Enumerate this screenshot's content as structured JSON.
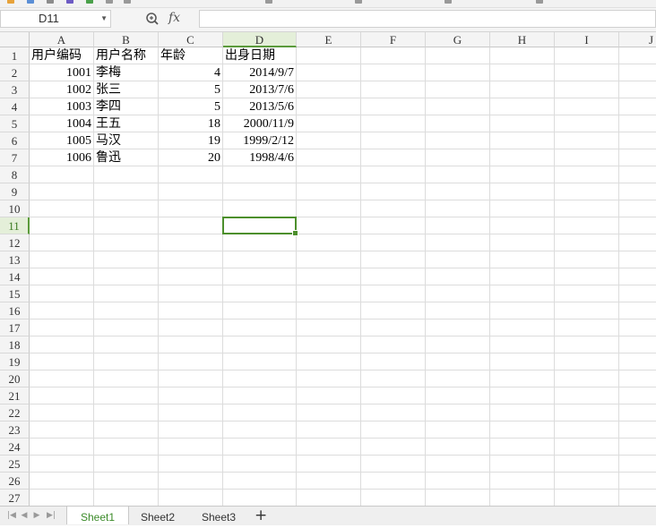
{
  "formula_bar": {
    "name_box": "D11",
    "fx_label": "fx",
    "formula": ""
  },
  "columns": [
    "A",
    "B",
    "C",
    "D",
    "E",
    "F",
    "G",
    "H",
    "I",
    "J"
  ],
  "rows": [
    "1",
    "2",
    "3",
    "4",
    "5",
    "6",
    "7",
    "8",
    "9",
    "10",
    "11",
    "12",
    "13",
    "14",
    "15",
    "16",
    "17",
    "18",
    "19",
    "20",
    "21",
    "22",
    "23",
    "24",
    "25",
    "26",
    "27"
  ],
  "table": {
    "headers": [
      "用户编码",
      "用户名称",
      "年龄",
      "出身日期"
    ],
    "records": [
      [
        "1001",
        "李梅",
        "4",
        "2014/9/7"
      ],
      [
        "1002",
        "张三",
        "5",
        "2013/7/6"
      ],
      [
        "1003",
        "李四",
        "5",
        "2013/5/6"
      ],
      [
        "1004",
        "王五",
        "18",
        "2000/11/9"
      ],
      [
        "1005",
        "马汉",
        "19",
        "1999/2/12"
      ],
      [
        "1006",
        "鲁迅",
        "20",
        "1998/4/6"
      ]
    ]
  },
  "selected_cell": "D11",
  "sheets": [
    "Sheet1",
    "Sheet2",
    "Sheet3"
  ],
  "active_sheet": "Sheet1",
  "colors": {
    "accent": "#4c8f2c",
    "active_tab_text": "#3a8a28"
  }
}
